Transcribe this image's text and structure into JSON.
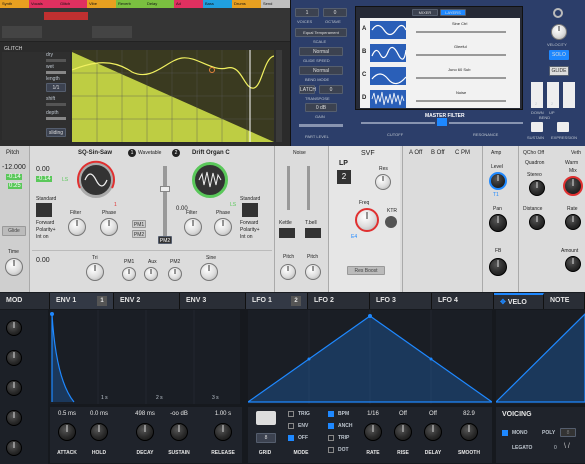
{
  "colors": {
    "accent_blue": "#1e88ff",
    "yellow": "#d6e84a",
    "orange": "#e8833a",
    "red": "#e03030",
    "green": "#5ac85a"
  },
  "top_left": {
    "tracks": [
      "Synth",
      "Vocals",
      "Glitch",
      "Vibe",
      "Reverb",
      "Delay",
      "Ad",
      "Bass",
      "Drums",
      "Send"
    ],
    "glitch_title": "GLITCH",
    "glitch_labels": [
      "dry",
      "wet",
      "length",
      "shift",
      "depth"
    ],
    "length_value": "1/1",
    "footer": "sliding"
  },
  "top_right": {
    "voices_label": "VOICES",
    "octave_label": "OCTAVE",
    "voices": "1",
    "octave": "0",
    "tuning": "Equal Temperament",
    "scale_label": "SCALE",
    "glide_speed_label": "GLIDE SPEED",
    "bend_mode_label": "BEND MODE",
    "transpose_label": "TRANSPOSE",
    "gain_label": "GAIN",
    "normal1": "Normal",
    "normal2": "Normal",
    "transpose": "0",
    "gain": "0 dB",
    "tabs": [
      "MIXER",
      "LAYERS"
    ],
    "layers": [
      {
        "id": "A",
        "name": "Sine Ctrl"
      },
      {
        "id": "B",
        "name": "Gleeful"
      },
      {
        "id": "C",
        "name": "Juno 60 Sub"
      },
      {
        "id": "D",
        "name": "Noise"
      }
    ],
    "master_filter": "MASTER FILTER",
    "cutoff": "CUTOFF",
    "resonance": "RESONANCE",
    "part_level": "PART LEVEL",
    "right_buttons": [
      "VELOCITY",
      "SOLO",
      "GLIDE",
      "SUSTAIN",
      "EXPRESSION"
    ],
    "down": "DOWN",
    "up": "UP",
    "bend": "BEND",
    "bend_down": "2",
    "bend_up": "2"
  },
  "middle": {
    "pitch_label": "Pitch",
    "pitch_values": [
      "-12.000",
      "-0.14",
      "0.25"
    ],
    "pitch_tags": [
      "LS",
      "LS"
    ],
    "glide": "Glide",
    "time": "Time",
    "osc1_num": "1",
    "osc1_name": "SQ-Sin-Saw",
    "osc1_type": "Wavetable",
    "osc2_num": "2",
    "osc2_name": "Drift Organ C",
    "osc_val1": "0.00",
    "osc_val2": "-0.14",
    "osc_val3": "0.00",
    "osc_val4": "0.00",
    "filter": "Filter",
    "phase": "Phase",
    "standard": "Standard",
    "forward": "Forward",
    "polarity": "Polarity+",
    "int_on": "Int on",
    "pm_labels": [
      "PM1",
      "PM2"
    ],
    "pm2b": "PM2",
    "mod_labels": [
      "Tri",
      "PM1",
      "Aux",
      "PM2",
      "Sine"
    ],
    "noise": "Noise",
    "kettle": "Kettle",
    "tbell": "T.bell",
    "pitch": "Pitch",
    "lp": "LP",
    "svf": "SVF",
    "filter_num": "2",
    "res": "Res",
    "freq": "Freq",
    "ktr": "KTR",
    "res_boost": "Res Boost",
    "a_off": "A Off",
    "b_off": "B Off",
    "c_pm": "C PM",
    "amp": "Amp",
    "level": "Level",
    "pan": "Pan",
    "fb": "FB",
    "qcho_off": "QCho Off",
    "quadron": "Quadron",
    "veth": "Veth",
    "warm": "Warm",
    "mix": "Mix",
    "stereo": "Stereo",
    "distance": "Distance",
    "rate": "Rate",
    "amount": "Amount",
    "t1": "T1",
    "e4": "E4"
  },
  "bottom": {
    "tabs": [
      {
        "label": "MOD"
      },
      {
        "label": "ENV 1",
        "num": "1"
      },
      {
        "label": "ENV 2"
      },
      {
        "label": "ENV 3"
      },
      {
        "label": "LFO 1",
        "num": "2"
      },
      {
        "label": "LFO 2"
      },
      {
        "label": "LFO 3"
      },
      {
        "label": "LFO 4"
      },
      {
        "label": "VELO"
      },
      {
        "label": "NOTE"
      }
    ],
    "env_times": [
      "1 s",
      "2 s",
      "3 s"
    ],
    "env_values": [
      {
        "v": "0.5 ms",
        "l": "ATTACK"
      },
      {
        "v": "0.0 ms",
        "l": "HOLD"
      },
      {
        "v": "498 ms",
        "l": "DECAY"
      },
      {
        "v": "-oo dB",
        "l": "SUSTAIN"
      },
      {
        "v": "1.00 s",
        "l": "RELEASE"
      }
    ],
    "grid": "GRID",
    "grid_value": "8",
    "mode_opts": [
      "TRIG",
      "ENV",
      "OFF"
    ],
    "mode": "MODE",
    "lfo_opts": [
      "BPM",
      "ANCH",
      "TRIP",
      "DOT"
    ],
    "lfo_values": [
      {
        "v": "1/16",
        "l": "RATE"
      },
      {
        "v": "Off",
        "l": "RISE"
      },
      {
        "v": "Off",
        "l": "DELAY"
      },
      {
        "v": "82.9",
        "l": "SMOOTH"
      }
    ],
    "voicing": "VOICING",
    "mono": "MONO",
    "poly": "POLY",
    "legato": "LEGATO",
    "poly_value": "8",
    "legato_value": "0"
  }
}
